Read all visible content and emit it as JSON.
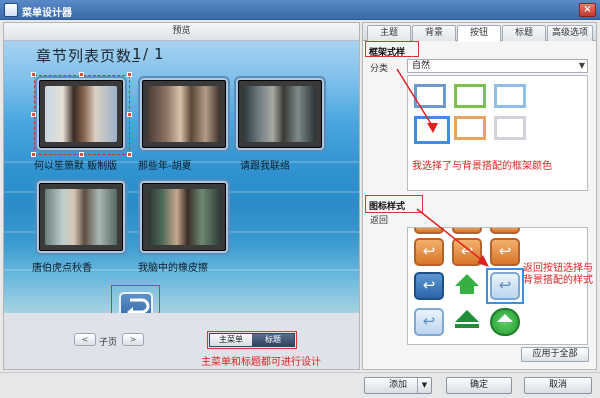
{
  "window": {
    "title": "菜单设计器"
  },
  "preview": {
    "header": "预览",
    "page_title": "章节列表页数",
    "page_current": "1",
    "page_separator": "/",
    "page_total": "1",
    "thumbs": [
      {
        "label": "何以笙箫默 贩制版"
      },
      {
        "label": "那些年-胡夏"
      },
      {
        "label": "请跟我联络"
      },
      {
        "label": "唐伯虎点秋香"
      },
      {
        "label": "我脑中的橡皮擦"
      }
    ],
    "nav": {
      "prev": "<",
      "page_label": "子页",
      "next": ">"
    },
    "segment": {
      "main_menu": "主菜单",
      "title": "标题"
    },
    "annotation_bottom": "主菜单和标题都可进行设计"
  },
  "right": {
    "tabs": [
      "主题",
      "背景",
      "按钮",
      "标题",
      "高级选项"
    ],
    "active_tab": "按钮",
    "frame_section": {
      "heading": "框架式样",
      "category_label": "分类",
      "category_value": "自然",
      "annotation": "我选择了与背景搭配的框架颜色"
    },
    "icon_section": {
      "heading": "图标样式",
      "row_label": "返回",
      "annotation": "返回按钮选择与背景搭配的样式",
      "apply_label": "应用于全部"
    }
  },
  "bottom": {
    "add_label": "添加",
    "confirm_label": "确定",
    "cancel_label": "取消"
  },
  "colors": {
    "annotation_red": "#e02020",
    "selection_blue": "#3b8ee0",
    "titlebar_blue": "#3a6aa8"
  }
}
